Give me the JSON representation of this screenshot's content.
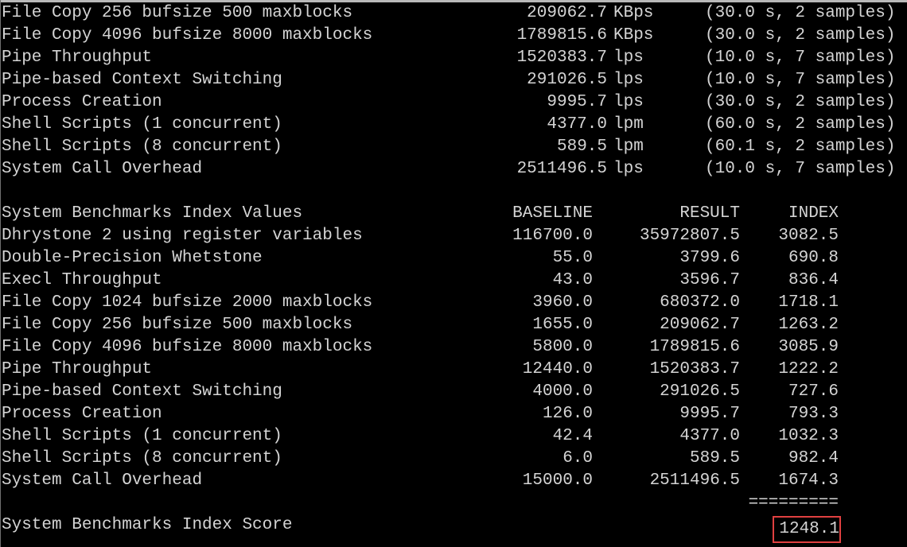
{
  "terminal": {
    "background_color": "#000000",
    "text_color": "#d4d4d4",
    "highlight_border_color": "#e04040"
  },
  "benchmark_results": {
    "rows": [
      {
        "name": "File Copy 256 bufsize 500 maxblocks",
        "value": "209062.7",
        "unit": "KBps",
        "samples": "(30.0 s, 2 samples)"
      },
      {
        "name": "File Copy 4096 bufsize 8000 maxblocks",
        "value": "1789815.6",
        "unit": "KBps",
        "samples": "(30.0 s, 2 samples)"
      },
      {
        "name": "Pipe Throughput",
        "value": "1520383.7",
        "unit": "lps",
        "samples": "(10.0 s, 7 samples)"
      },
      {
        "name": "Pipe-based Context Switching",
        "value": "291026.5",
        "unit": "lps",
        "samples": "(10.0 s, 7 samples)"
      },
      {
        "name": "Process Creation",
        "value": "9995.7",
        "unit": "lps",
        "samples": "(30.0 s, 2 samples)"
      },
      {
        "name": "Shell Scripts (1 concurrent)",
        "value": "4377.0",
        "unit": "lpm",
        "samples": "(60.0 s, 2 samples)"
      },
      {
        "name": "Shell Scripts (8 concurrent)",
        "value": "589.5",
        "unit": "lpm",
        "samples": "(60.1 s, 2 samples)"
      },
      {
        "name": "System Call Overhead",
        "value": "2511496.5",
        "unit": "lps",
        "samples": "(10.0 s, 7 samples)"
      }
    ]
  },
  "index_table": {
    "title": "System Benchmarks Index Values",
    "headers": {
      "baseline": "BASELINE",
      "result": "RESULT",
      "index": "INDEX"
    },
    "rows": [
      {
        "name": "Dhrystone 2 using register variables",
        "baseline": "116700.0",
        "result": "35972807.5",
        "index": "3082.5"
      },
      {
        "name": "Double-Precision Whetstone",
        "baseline": "55.0",
        "result": "3799.6",
        "index": "690.8"
      },
      {
        "name": "Execl Throughput",
        "baseline": "43.0",
        "result": "3596.7",
        "index": "836.4"
      },
      {
        "name": "File Copy 1024 bufsize 2000 maxblocks",
        "baseline": "3960.0",
        "result": "680372.0",
        "index": "1718.1"
      },
      {
        "name": "File Copy 256 bufsize 500 maxblocks",
        "baseline": "1655.0",
        "result": "209062.7",
        "index": "1263.2"
      },
      {
        "name": "File Copy 4096 bufsize 8000 maxblocks",
        "baseline": "5800.0",
        "result": "1789815.6",
        "index": "3085.9"
      },
      {
        "name": "Pipe Throughput",
        "baseline": "12440.0",
        "result": "1520383.7",
        "index": "1222.2"
      },
      {
        "name": "Pipe-based Context Switching",
        "baseline": "4000.0",
        "result": "291026.5",
        "index": "727.6"
      },
      {
        "name": "Process Creation",
        "baseline": "126.0",
        "result": "9995.7",
        "index": "793.3"
      },
      {
        "name": "Shell Scripts (1 concurrent)",
        "baseline": "42.4",
        "result": "4377.0",
        "index": "1032.3"
      },
      {
        "name": "Shell Scripts (8 concurrent)",
        "baseline": "6.0",
        "result": "589.5",
        "index": "982.4"
      },
      {
        "name": "System Call Overhead",
        "baseline": "15000.0",
        "result": "2511496.5",
        "index": "1674.3"
      }
    ],
    "separator": "=========",
    "score_label": "System Benchmarks Index Score",
    "score_value": "1248.1"
  }
}
